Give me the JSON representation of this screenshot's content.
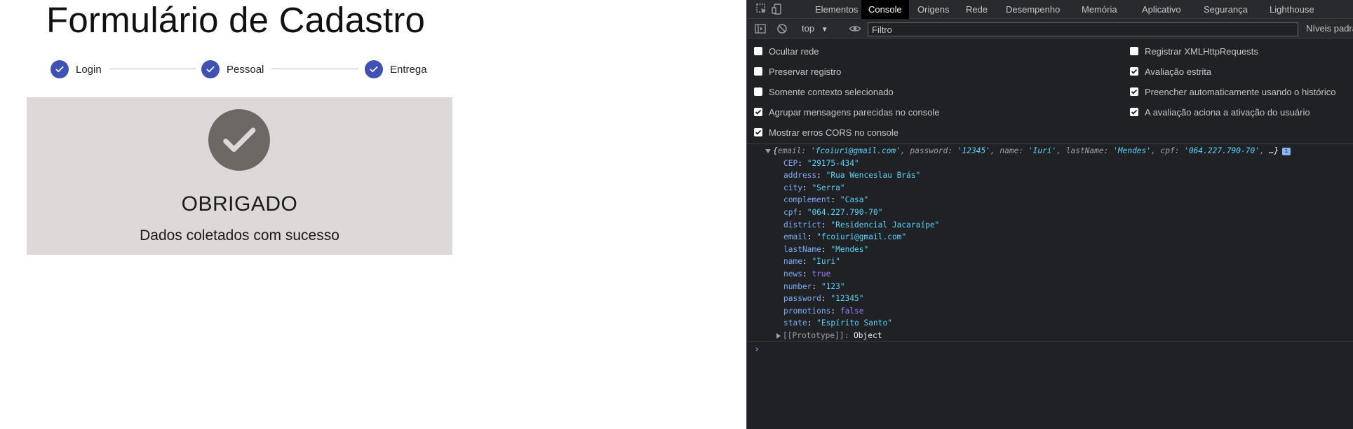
{
  "page": {
    "title": "Formulário de Cadastro",
    "steps": [
      {
        "label": "Login",
        "completed": true
      },
      {
        "label": "Pessoal",
        "completed": true
      },
      {
        "label": "Entrega",
        "completed": true
      }
    ],
    "success": {
      "heading": "OBRIGADO",
      "message": "Dados coletados com sucesso"
    }
  },
  "devtools": {
    "tabs": [
      "Elementos",
      "Console",
      "Origens",
      "Rede",
      "Desempenho",
      "Memória",
      "Aplicativo",
      "Segurança",
      "Lighthouse"
    ],
    "active_tab": "Console",
    "context": "top",
    "filter_placeholder": "Filtro",
    "levels_label": "Níveis padrão",
    "settings": [
      {
        "label": "Ocultar rede",
        "checked": false
      },
      {
        "label": "Preservar registro",
        "checked": false
      },
      {
        "label": "Somente contexto selecionado",
        "checked": false
      },
      {
        "label": "Agrupar mensagens parecidas no console",
        "checked": true
      },
      {
        "label": "Mostrar erros CORS no console",
        "checked": true
      },
      {
        "label": "Registrar XMLHttpRequests",
        "checked": false
      },
      {
        "label": "Avaliação estrita",
        "checked": true
      },
      {
        "label": "Preencher automaticamente usando o histórico",
        "checked": true
      },
      {
        "label": "A avaliação aciona a ativação do usuário",
        "checked": true
      }
    ],
    "log_summary": {
      "open": "{",
      "preview": [
        {
          "key": "email",
          "value": "'fcoiuri@gmail.com'"
        },
        {
          "key": "password",
          "value": "'12345'"
        },
        {
          "key": "name",
          "value": "'Iuri'"
        },
        {
          "key": "lastName",
          "value": "'Mendes'"
        },
        {
          "key": "cpf",
          "value": "'064.227.790-70'"
        }
      ],
      "ellipsis": "…}",
      "info_badge": "i"
    },
    "log_properties": [
      {
        "key": "CEP",
        "value": "\"29175-434\"",
        "type": "string"
      },
      {
        "key": "address",
        "value": "\"Rua Wenceslau Brás\"",
        "type": "string"
      },
      {
        "key": "city",
        "value": "\"Serra\"",
        "type": "string"
      },
      {
        "key": "complement",
        "value": "\"Casa\"",
        "type": "string"
      },
      {
        "key": "cpf",
        "value": "\"064.227.790-70\"",
        "type": "string"
      },
      {
        "key": "district",
        "value": "\"Residencial Jacaraípe\"",
        "type": "string"
      },
      {
        "key": "email",
        "value": "\"fcoiuri@gmail.com\"",
        "type": "string"
      },
      {
        "key": "lastName",
        "value": "\"Mendes\"",
        "type": "string"
      },
      {
        "key": "name",
        "value": "\"Iuri\"",
        "type": "string"
      },
      {
        "key": "news",
        "value": "true",
        "type": "boolean"
      },
      {
        "key": "number",
        "value": "\"123\"",
        "type": "string"
      },
      {
        "key": "password",
        "value": "\"12345\"",
        "type": "string"
      },
      {
        "key": "promotions",
        "value": "false",
        "type": "boolean"
      },
      {
        "key": "state",
        "value": "\"Espírito Santo\"",
        "type": "string"
      }
    ],
    "prototype": {
      "key": "[[Prototype]]",
      "value": "Object"
    },
    "prompt": "›"
  },
  "colors": {
    "stepper_accent": "#3f51b5",
    "card_background": "#ded8d8",
    "check_circle": "#6d6864",
    "devtools_background": "#202124",
    "string_value": "#5cd5fb",
    "boolean_value": "#9980ff"
  },
  "icons": {
    "step_check": "check-icon",
    "success_check": "check-circle-icon",
    "inspect": "inspect-element-icon",
    "device": "device-toolbar-icon",
    "sidebar": "sidebar-toggle-icon",
    "clear": "clear-console-icon",
    "eye": "live-expression-icon"
  }
}
